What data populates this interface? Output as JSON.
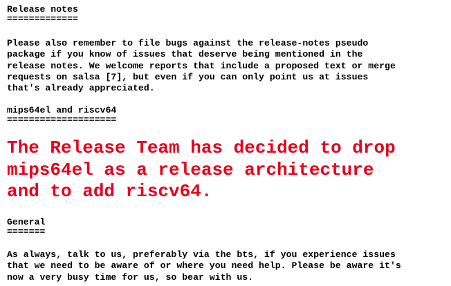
{
  "colors": {
    "text": "#000000",
    "highlight": "#e8001c",
    "background": "#ffffff"
  },
  "sections": {
    "release_notes": {
      "heading": "Release notes",
      "underline": "=============",
      "body_lines": [
        "Please also remember to file bugs against the release-notes pseudo",
        "package if you know of issues that deserve being mentioned in the",
        "release notes. We welcome reports that include a proposed text or merge",
        "requests on salsa [7], but even if you can only point us at issues",
        "that's already appreciated."
      ]
    },
    "architectures": {
      "heading": "mips64el and riscv64",
      "underline": "====================",
      "announcement_lines": [
        "The Release Team has decided to drop",
        "mips64el as a release architecture",
        "and to add riscv64."
      ]
    },
    "general": {
      "heading": "General",
      "underline": "=======",
      "body_lines": [
        "As always, talk to us, preferably via the bts, if you experience issues",
        "that we need to be aware of or where you need help. Please be aware it's",
        "now a very busy time for us, so bear with us."
      ]
    }
  }
}
